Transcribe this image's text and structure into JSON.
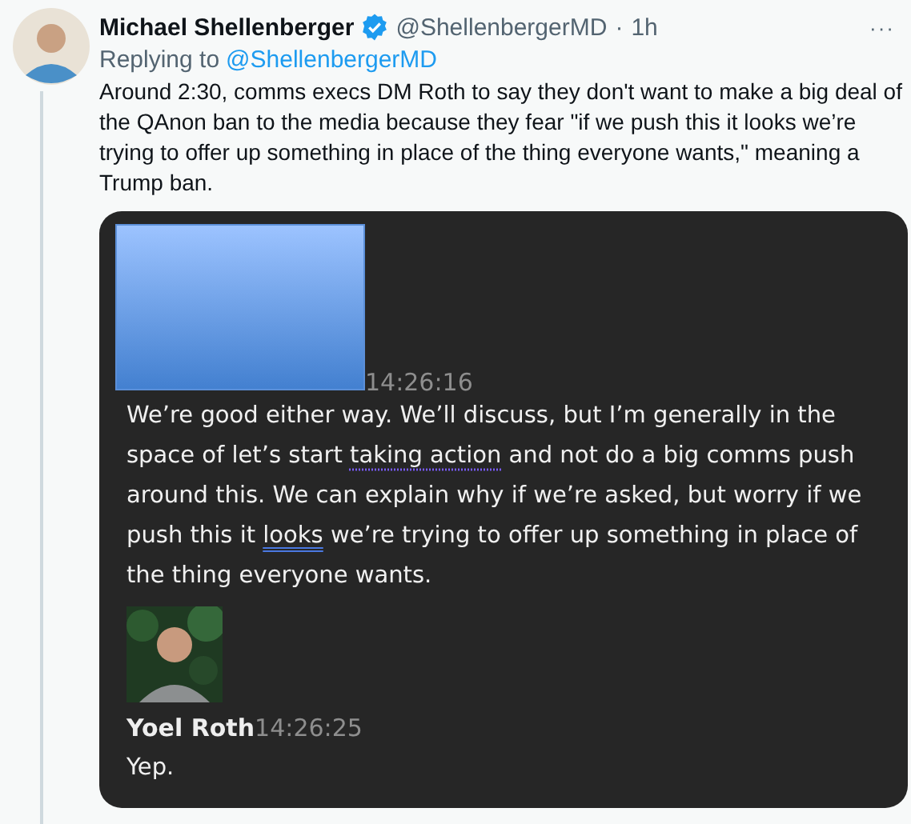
{
  "tweet": {
    "author": "Michael Shellenberger",
    "verified": true,
    "handle": "@ShellenbergerMD",
    "separator": "·",
    "time": "1h",
    "more": "···",
    "reply_prefix": "Replying to",
    "reply_to": "@ShellenbergerMD",
    "text": "Around 2:30, comms execs DM Roth to say they don't want to make a big deal of the QAnon ban to the media because they fear \"if we push this it looks we’re trying to offer up something in place of the thing everyone wants,\" meaning a Trump ban."
  },
  "chat": {
    "messages": [
      {
        "kind": "redacted",
        "time": "14:26:16",
        "segments": [
          {
            "text": "We’re good either way. We’ll discuss, but I’m generally in the space of let’s start "
          },
          {
            "text": "taking action",
            "dotted_underline": true
          },
          {
            "text": " and not do a big comms push around this. We can explain why if we’re asked, but worry if we push this it "
          },
          {
            "text": "looks",
            "double_underline": true
          },
          {
            "text": " we’re trying to offer up something in place of the thing everyone wants."
          }
        ]
      },
      {
        "kind": "named",
        "sender": "Yoel Roth",
        "time": "14:26:25",
        "segments": [
          {
            "text": "Yep."
          }
        ]
      }
    ]
  }
}
